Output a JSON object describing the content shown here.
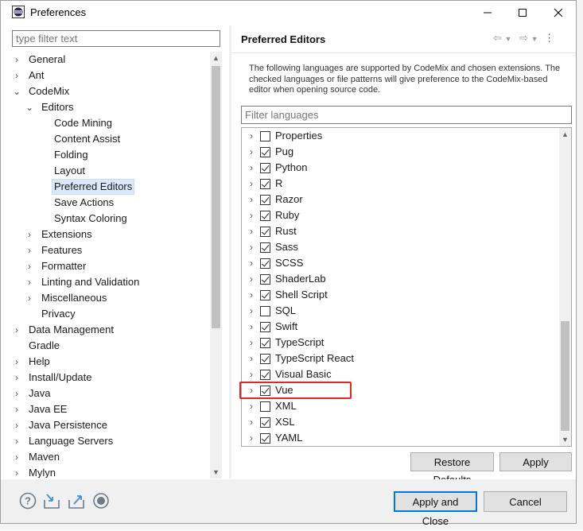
{
  "window": {
    "title": "Preferences"
  },
  "left": {
    "filter_placeholder": "type filter text",
    "tree": [
      {
        "label": "General",
        "level": 0,
        "expander": "›"
      },
      {
        "label": "Ant",
        "level": 0,
        "expander": "›"
      },
      {
        "label": "CodeMix",
        "level": 0,
        "expander": "⌄"
      },
      {
        "label": "Editors",
        "level": 1,
        "expander": "⌄"
      },
      {
        "label": "Code Mining",
        "level": 2,
        "expander": ""
      },
      {
        "label": "Content Assist",
        "level": 2,
        "expander": ""
      },
      {
        "label": "Folding",
        "level": 2,
        "expander": ""
      },
      {
        "label": "Layout",
        "level": 2,
        "expander": ""
      },
      {
        "label": "Preferred Editors",
        "level": 2,
        "expander": "",
        "selected": true
      },
      {
        "label": "Save Actions",
        "level": 2,
        "expander": ""
      },
      {
        "label": "Syntax Coloring",
        "level": 2,
        "expander": ""
      },
      {
        "label": "Extensions",
        "level": 1,
        "expander": "›"
      },
      {
        "label": "Features",
        "level": 1,
        "expander": "›"
      },
      {
        "label": "Formatter",
        "level": 1,
        "expander": "›"
      },
      {
        "label": "Linting and Validation",
        "level": 1,
        "expander": "›"
      },
      {
        "label": "Miscellaneous",
        "level": 1,
        "expander": "›"
      },
      {
        "label": "Privacy",
        "level": 1,
        "expander": ""
      },
      {
        "label": "Data Management",
        "level": 0,
        "expander": "›"
      },
      {
        "label": "Gradle",
        "level": 0,
        "expander": ""
      },
      {
        "label": "Help",
        "level": 0,
        "expander": "›"
      },
      {
        "label": "Install/Update",
        "level": 0,
        "expander": "›"
      },
      {
        "label": "Java",
        "level": 0,
        "expander": "›"
      },
      {
        "label": "Java EE",
        "level": 0,
        "expander": "›"
      },
      {
        "label": "Java Persistence",
        "level": 0,
        "expander": "›"
      },
      {
        "label": "Language Servers",
        "level": 0,
        "expander": "›"
      },
      {
        "label": "Maven",
        "level": 0,
        "expander": "›"
      },
      {
        "label": "Mylyn",
        "level": 0,
        "expander": "›"
      }
    ]
  },
  "right": {
    "title": "Preferred Editors",
    "description": "The following languages are supported by CodeMix and chosen extensions. The checked languages or file patterns will give preference to the CodeMix-based editor when opening source code.",
    "filter_placeholder": "Filter languages",
    "languages": [
      {
        "name": "Properties",
        "checked": false
      },
      {
        "name": "Pug",
        "checked": true
      },
      {
        "name": "Python",
        "checked": true
      },
      {
        "name": "R",
        "checked": true
      },
      {
        "name": "Razor",
        "checked": true
      },
      {
        "name": "Ruby",
        "checked": true
      },
      {
        "name": "Rust",
        "checked": true
      },
      {
        "name": "Sass",
        "checked": true
      },
      {
        "name": "SCSS",
        "checked": true
      },
      {
        "name": "ShaderLab",
        "checked": true
      },
      {
        "name": "Shell Script",
        "checked": true
      },
      {
        "name": "SQL",
        "checked": false
      },
      {
        "name": "Swift",
        "checked": true
      },
      {
        "name": "TypeScript",
        "checked": true
      },
      {
        "name": "TypeScript React",
        "checked": true
      },
      {
        "name": "Visual Basic",
        "checked": true
      },
      {
        "name": "Vue",
        "checked": true
      },
      {
        "name": "XML",
        "checked": false
      },
      {
        "name": "XSL",
        "checked": true
      },
      {
        "name": "YAML",
        "checked": true
      }
    ],
    "highlighted_language": "Vue",
    "restore_defaults_label": "Restore Defaults",
    "apply_label": "Apply"
  },
  "footer": {
    "apply_close_label": "Apply and Close",
    "cancel_label": "Cancel"
  },
  "colors": {
    "highlight_border": "#e3242b",
    "selection_bg": "#d9e8fb",
    "primary_border": "#0078d7"
  }
}
